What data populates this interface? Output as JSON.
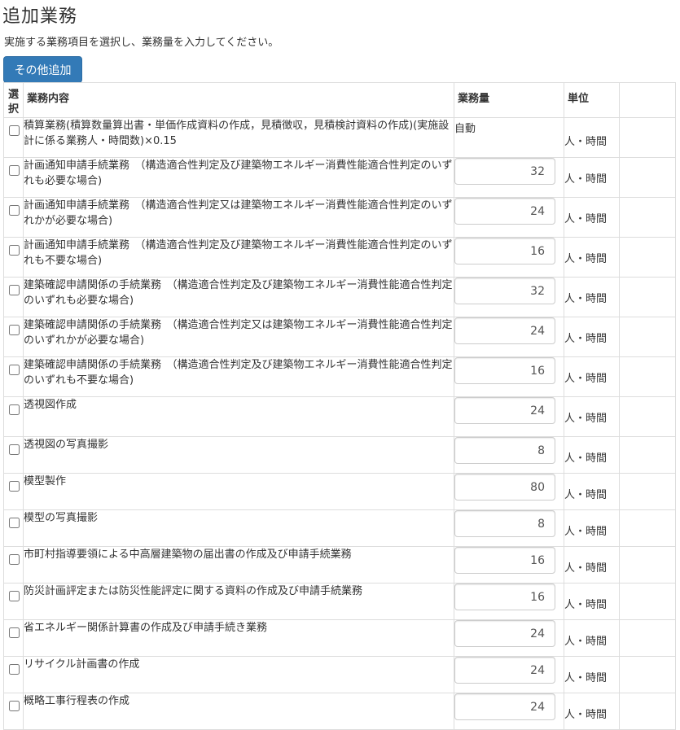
{
  "page": {
    "title": "追加業務",
    "subtitle": "実施する業務項目を選択し、業務量を入力してください。",
    "add_button": "その他追加"
  },
  "table": {
    "headers": {
      "select": "選択",
      "content": "業務内容",
      "quantity": "業務量",
      "unit": "単位",
      "extra": ""
    },
    "rows": [
      {
        "desc": "積算業務(積算数量算出書・単価作成資料の作成，見積徴収，見積検討資料の作成)(実施設計に係る業務人・時間数)×0.15",
        "qty": "自動",
        "auto": true,
        "unit": "人・時間"
      },
      {
        "desc": "計画通知申請手続業務　（構造適合性判定及び建築物エネルギー消費性能適合性判定のいずれも必要な場合)",
        "qty": "32",
        "auto": false,
        "unit": "人・時間"
      },
      {
        "desc": "計画通知申請手続業務　（構造適合性判定又は建築物エネルギー消費性能適合性判定のいずれかが必要な場合)",
        "qty": "24",
        "auto": false,
        "unit": "人・時間"
      },
      {
        "desc": "計画通知申請手続業務　（構造適合性判定及び建築物エネルギー消費性能適合性判定のいずれも不要な場合)",
        "qty": "16",
        "auto": false,
        "unit": "人・時間"
      },
      {
        "desc": "建築確認申請関係の手続業務　（構造適合性判定及び建築物エネルギー消費性能適合性判定のいずれも必要な場合)",
        "qty": "32",
        "auto": false,
        "unit": "人・時間"
      },
      {
        "desc": "建築確認申請関係の手続業務　（構造適合性判定又は建築物エネルギー消費性能適合性判定のいずれかが必要な場合)",
        "qty": "24",
        "auto": false,
        "unit": "人・時間"
      },
      {
        "desc": "建築確認申請関係の手続業務　（構造適合性判定及び建築物エネルギー消費性能適合性判定のいずれも不要な場合)",
        "qty": "16",
        "auto": false,
        "unit": "人・時間"
      },
      {
        "desc": "透視図作成",
        "qty": "24",
        "auto": false,
        "unit": "人・時間"
      },
      {
        "desc": "透視図の写真撮影",
        "qty": "8",
        "auto": false,
        "unit": "人・時間"
      },
      {
        "desc": "模型製作",
        "qty": "80",
        "auto": false,
        "unit": "人・時間"
      },
      {
        "desc": "模型の写真撮影",
        "qty": "8",
        "auto": false,
        "unit": "人・時間"
      },
      {
        "desc": "市町村指導要領による中高層建築物の届出書の作成及び申請手続業務",
        "qty": "16",
        "auto": false,
        "unit": "人・時間"
      },
      {
        "desc": "防災計画評定または防災性能評定に関する資料の作成及び申請手続業務",
        "qty": "16",
        "auto": false,
        "unit": "人・時間"
      },
      {
        "desc": "省エネルギー関係計算書の作成及び申請手続き業務",
        "qty": "24",
        "auto": false,
        "unit": "人・時間"
      },
      {
        "desc": "リサイクル計画書の作成",
        "qty": "24",
        "auto": false,
        "unit": "人・時間"
      },
      {
        "desc": "概略工事行程表の作成",
        "qty": "24",
        "auto": false,
        "unit": "人・時間"
      }
    ]
  }
}
